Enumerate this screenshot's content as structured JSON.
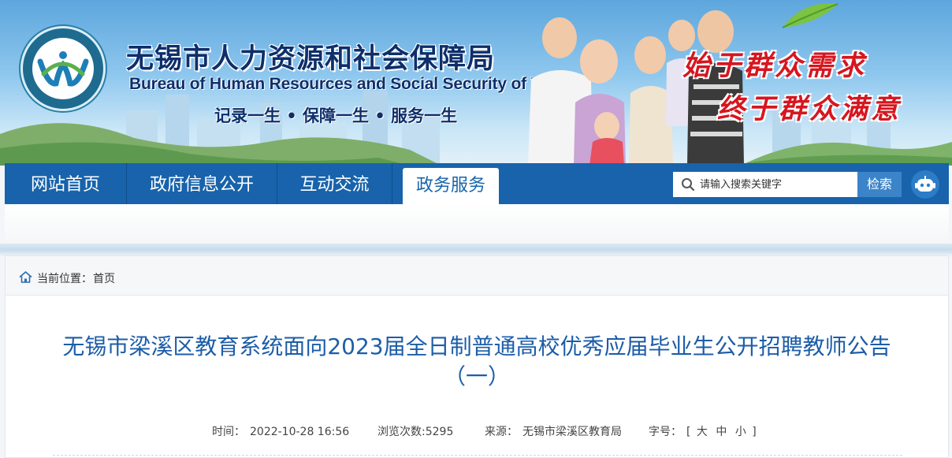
{
  "site": {
    "title_cn": "无锡市人力资源和社会保障局",
    "title_en": "Bureau of Human Resources and Social Security of WuXi",
    "slogan": "记录一生 • 保障一生 • 服务一生",
    "motto_line1": "始于群众需求",
    "motto_line2": "终于群众满意"
  },
  "nav": {
    "items": [
      {
        "label": "网站首页"
      },
      {
        "label": "政府信息公开"
      },
      {
        "label": "互动交流"
      },
      {
        "label": "政务服务"
      }
    ],
    "active_index": 3
  },
  "search": {
    "placeholder": "请输入搜索关键字",
    "button_label": "检索"
  },
  "breadcrumb": {
    "label": "当前位置：",
    "home": "首页"
  },
  "article": {
    "title": "无锡市梁溪区教育系统面向2023届全日制普通高校优秀应届毕业生公开招聘教师公告（一）",
    "time_label": "时间：",
    "time": "2022-10-28 16:56",
    "views_label": "浏览次数:",
    "views": "5295",
    "source_label": "来源：",
    "source": "无锡市梁溪区教育局",
    "fontsize_label": "字号：",
    "fontsize_open": "[",
    "fontsize_large": "大",
    "fontsize_medium": "中",
    "fontsize_small": "小",
    "fontsize_close": "]"
  },
  "colors": {
    "nav_bg": "#1863ab",
    "title_blue": "#1c5da8",
    "motto_red": "#d6161f",
    "brand_navy": "#0e2f6b"
  },
  "icons": {
    "search": "search-icon",
    "home": "home-icon",
    "robot": "robot-assistant-icon",
    "logo": "bureau-logo"
  }
}
